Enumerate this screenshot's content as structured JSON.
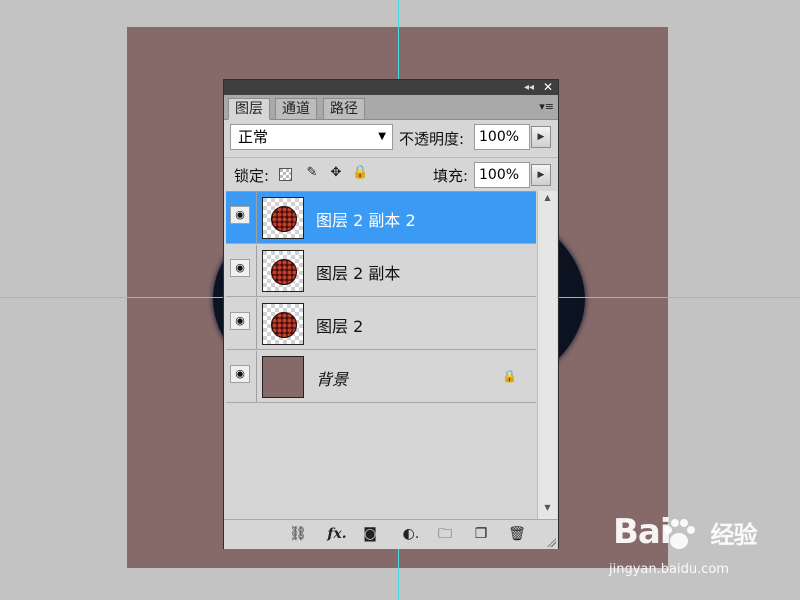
{
  "panel": {
    "tabs": [
      {
        "label": "图层",
        "active": true
      },
      {
        "label": "通道",
        "active": false
      },
      {
        "label": "路径",
        "active": false
      }
    ],
    "blend_mode": "正常",
    "opacity_label": "不透明度:",
    "opacity_value": "100%",
    "lock_label": "锁定:",
    "fill_label": "填充:",
    "fill_value": "100%",
    "layers": [
      {
        "name": "图层 2 副本 2",
        "selected": true,
        "visible": true
      },
      {
        "name": "图层 2 副本",
        "selected": false,
        "visible": true
      },
      {
        "name": "图层 2",
        "selected": false,
        "visible": true
      },
      {
        "name": "背景",
        "selected": false,
        "visible": true,
        "locked": true
      }
    ],
    "footer_fx": "fx"
  },
  "watermark": {
    "logo": "Bai",
    "logo_suffix": "经验",
    "url": "jingyan.baidu.com"
  },
  "colors": {
    "selection": "#3a9af4",
    "canvas": "#866a6a",
    "guides": "#49d9e2"
  }
}
